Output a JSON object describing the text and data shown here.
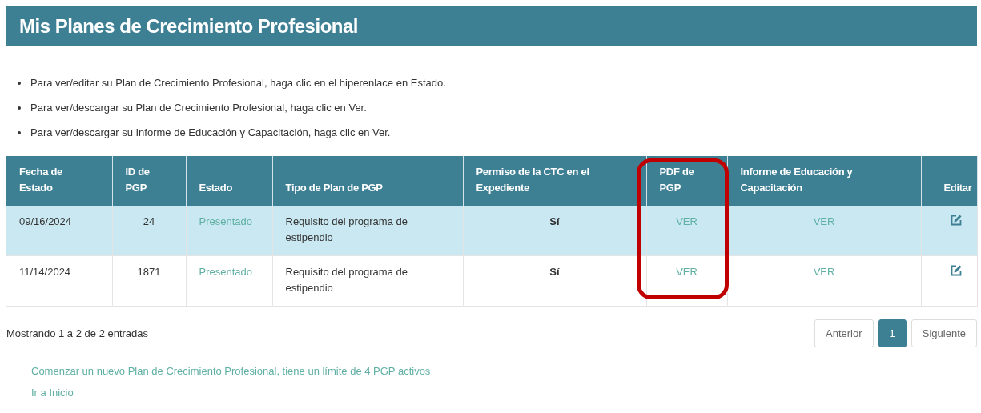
{
  "title": "Mis Planes de Crecimiento Profesional",
  "instructions": [
    "Para ver/editar su Plan de Crecimiento Profesional, haga clic en el hiperenlace en Estado.",
    "Para ver/descargar su Plan de Crecimiento Profesional, haga clic en Ver.",
    "Para ver/descargar su Informe de Educación y Capacitación, haga clic en Ver."
  ],
  "table": {
    "columns": [
      {
        "label": "Fecha de Estado",
        "highlighted": false
      },
      {
        "label": "ID de PGP",
        "highlighted": false
      },
      {
        "label": "Estado",
        "highlighted": false
      },
      {
        "label": "Tipo de Plan de PGP",
        "highlighted": false
      },
      {
        "label": "Permiso de la CTC en el Expediente",
        "highlighted": false
      },
      {
        "label": "PDF de PGP",
        "highlighted": true
      },
      {
        "label": "Informe de Educación y Capacitación",
        "highlighted": false
      },
      {
        "label": "Editar",
        "highlighted": false
      }
    ],
    "rows": [
      {
        "selected": true,
        "fecha": "09/16/2024",
        "id": "24",
        "estado": "Presentado",
        "tipo": "Requisito del programa de estipendio",
        "permiso": "Sí",
        "pdf": "VER",
        "informe": "VER"
      },
      {
        "selected": false,
        "fecha": "11/14/2024",
        "id": "1871",
        "estado": "Presentado",
        "tipo": "Requisito del programa de estipendio",
        "permiso": "Sí",
        "pdf": "VER",
        "informe": "VER"
      }
    ]
  },
  "info": "Mostrando 1 a 2 de 2 entradas",
  "pagination": [
    {
      "label": "Anterior",
      "selected": false
    },
    {
      "label": "1",
      "selected": true
    },
    {
      "label": "Siguiente",
      "selected": false
    }
  ],
  "links": [
    "Comenzar un nuevo Plan de Crecimiento Profesional, tiene un límite de 4 PGP activos",
    "Ir a Inicio"
  ]
}
